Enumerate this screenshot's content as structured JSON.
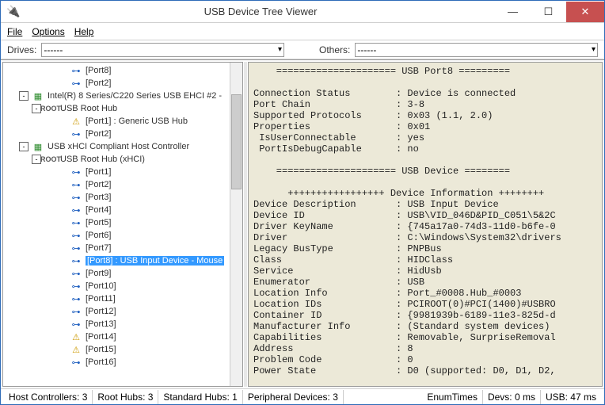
{
  "window": {
    "title": "USB Device Tree Viewer"
  },
  "menu": {
    "file": "File",
    "options": "Options",
    "help": "Help"
  },
  "toolbar": {
    "drives_label": "Drives:",
    "drives_value": "------",
    "others_label": "Others:",
    "others_value": "------"
  },
  "tree": [
    {
      "indent": 4,
      "expander": "",
      "icon": "usb",
      "label": "[Port8]"
    },
    {
      "indent": 4,
      "expander": "",
      "icon": "usb",
      "label": "[Port2]"
    },
    {
      "indent": 1,
      "expander": "-",
      "icon": "card",
      "label": "Intel(R) 8 Series/C220 Series USB EHCI #2 -"
    },
    {
      "indent": 2,
      "expander": "-",
      "icon": "hub",
      "label": "USB Root Hub"
    },
    {
      "indent": 4,
      "expander": "",
      "icon": "warn",
      "label": "[Port1] : Generic USB Hub"
    },
    {
      "indent": 4,
      "expander": "",
      "icon": "usb",
      "label": "[Port2]"
    },
    {
      "indent": 1,
      "expander": "-",
      "icon": "card",
      "label": "USB xHCI Compliant Host Controller"
    },
    {
      "indent": 2,
      "expander": "-",
      "icon": "hub",
      "label": "USB Root Hub (xHCI)"
    },
    {
      "indent": 4,
      "expander": "",
      "icon": "usb",
      "label": "[Port1]"
    },
    {
      "indent": 4,
      "expander": "",
      "icon": "usb",
      "label": "[Port2]"
    },
    {
      "indent": 4,
      "expander": "",
      "icon": "usb",
      "label": "[Port3]"
    },
    {
      "indent": 4,
      "expander": "",
      "icon": "usb",
      "label": "[Port4]"
    },
    {
      "indent": 4,
      "expander": "",
      "icon": "usb",
      "label": "[Port5]"
    },
    {
      "indent": 4,
      "expander": "",
      "icon": "usb",
      "label": "[Port6]"
    },
    {
      "indent": 4,
      "expander": "",
      "icon": "usb",
      "label": "[Port7]"
    },
    {
      "indent": 4,
      "expander": "",
      "icon": "usb",
      "label": "[Port8] : USB Input Device - Mouse",
      "selected": true
    },
    {
      "indent": 4,
      "expander": "",
      "icon": "usb",
      "label": "[Port9]"
    },
    {
      "indent": 4,
      "expander": "",
      "icon": "usb",
      "label": "[Port10]"
    },
    {
      "indent": 4,
      "expander": "",
      "icon": "usb",
      "label": "[Port11]"
    },
    {
      "indent": 4,
      "expander": "",
      "icon": "usb",
      "label": "[Port12]"
    },
    {
      "indent": 4,
      "expander": "",
      "icon": "usb",
      "label": "[Port13]"
    },
    {
      "indent": 4,
      "expander": "",
      "icon": "warn",
      "label": "[Port14]"
    },
    {
      "indent": 4,
      "expander": "",
      "icon": "warn",
      "label": "[Port15]"
    },
    {
      "indent": 4,
      "expander": "",
      "icon": "usb",
      "label": "[Port16]"
    }
  ],
  "detail_lines": [
    "    ===================== USB Port8 =========",
    "",
    "Connection Status        : Device is connected",
    "Port Chain               : 3-8",
    "Supported Protocols      : 0x03 (1.1, 2.0)",
    "Properties               : 0x01",
    " IsUserConnectable       : yes",
    " PortIsDebugCapable      : no",
    "",
    "    ===================== USB Device ========",
    "",
    "      +++++++++++++++++ Device Information ++++++++",
    "Device Description       : USB Input Device",
    "Device ID                : USB\\VID_046D&PID_C051\\5&2C",
    "Driver KeyName           : {745a17a0-74d3-11d0-b6fe-0",
    "Driver                   : C:\\Windows\\System32\\drivers",
    "Legacy BusType           : PNPBus",
    "Class                    : HIDClass",
    "Service                  : HidUsb",
    "Enumerator               : USB",
    "Location Info            : Port_#0008.Hub_#0003",
    "Location IDs             : PCIROOT(0)#PCI(1400)#USBRO",
    "Container ID             : {9981939b-6189-11e3-825d-d",
    "Manufacturer Info        : (Standard system devices)",
    "Capabilities             : Removable, SurpriseRemoval",
    "Address                  : 8",
    "Problem Code             : 0",
    "Power State              : D0 (supported: D0, D1, D2,"
  ],
  "status": {
    "host_controllers": "Host Controllers: 3",
    "root_hubs": "Root Hubs: 3",
    "standard_hubs": "Standard Hubs: 1",
    "peripheral": "Peripheral Devices: 3",
    "enum_times": "EnumTimes",
    "devs": "Devs: 0 ms",
    "usb": "USB: 47 ms"
  },
  "icons": {
    "usb_glyph": "⊶",
    "hub_glyph": "ROOT",
    "card_glyph": "▦",
    "warn_glyph": "⚠"
  }
}
